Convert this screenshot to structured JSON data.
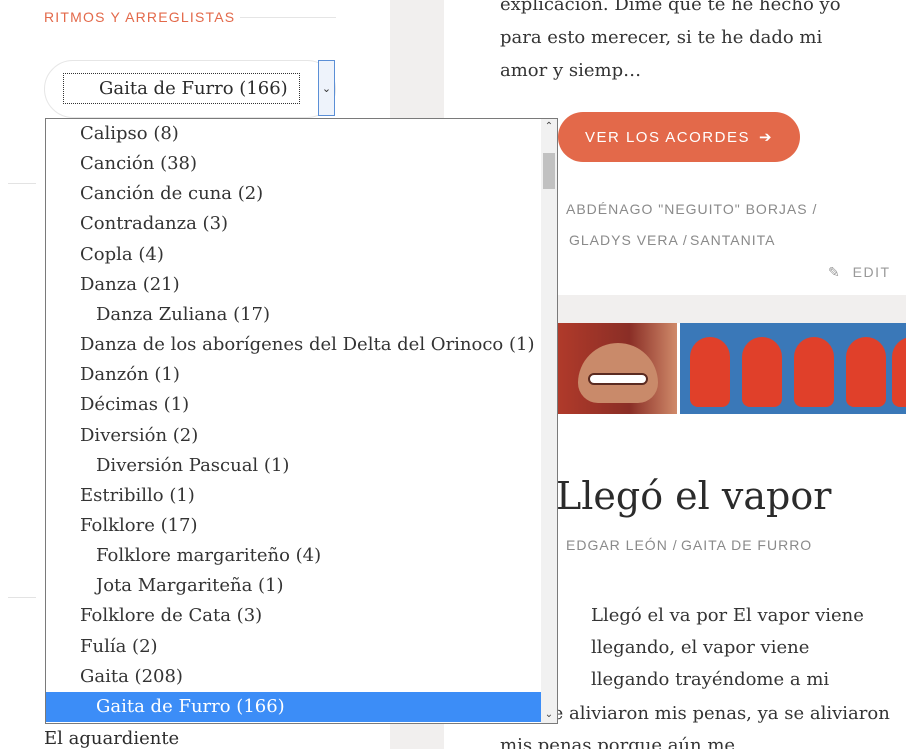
{
  "sidebar": {
    "title": "RITMOS Y ARREGLISTAS",
    "select_value": "Gaita de Furro  (166)",
    "below_text": "El aguardiente"
  },
  "dropdown": {
    "items": [
      {
        "label": "Calipso  (8)",
        "child": false
      },
      {
        "label": "Canción  (38)",
        "child": false
      },
      {
        "label": "Canción de cuna  (2)",
        "child": false
      },
      {
        "label": "Contradanza  (3)",
        "child": false
      },
      {
        "label": "Copla  (4)",
        "child": false
      },
      {
        "label": "Danza  (21)",
        "child": false
      },
      {
        "label": "Danza Zuliana  (17)",
        "child": true
      },
      {
        "label": "Danza de los aborígenes del Delta del Orinoco  (1)",
        "child": false
      },
      {
        "label": "Danzón  (1)",
        "child": false
      },
      {
        "label": "Décimas  (1)",
        "child": false
      },
      {
        "label": "Diversión  (2)",
        "child": false
      },
      {
        "label": "Diversión Pascual  (1)",
        "child": true
      },
      {
        "label": "Estribillo  (1)",
        "child": false
      },
      {
        "label": "Folklore  (17)",
        "child": false
      },
      {
        "label": "Folklore margariteño  (4)",
        "child": true
      },
      {
        "label": "Jota Margariteña  (1)",
        "child": true
      },
      {
        "label": "Folklore de Cata  (3)",
        "child": false
      },
      {
        "label": "Fulía  (2)",
        "child": false
      },
      {
        "label": "Gaita  (208)",
        "child": false
      },
      {
        "label": "Gaita de Furro  (166)",
        "child": true,
        "selected": true
      }
    ]
  },
  "post1": {
    "excerpt": "explicación. Dime que te he hecho yo para esto merecer, si te he dado mi amor y siemp…",
    "button_label": "VER LOS ACORDES",
    "meta_line1": "ABDÉNAGO \"NEGUITO\" BORJAS /",
    "meta_line2_a": "GLADYS VERA /",
    "meta_line2_b": "SANTANITA",
    "edit_label": "EDIT"
  },
  "post2": {
    "title": "Llegó el vapor",
    "meta_author": "EDGAR LEÓN /",
    "meta_rhythm": "GAITA DE FURRO",
    "content": "Llegó el va por El vapor viene llegando, el vapor viene llegando trayéndome a mi",
    "content2": "a Ya se aliviaron mis penas, ya se aliviaron mis penas porque aún me"
  },
  "colors": {
    "accent": "#e3694a",
    "selection": "#3c8df7"
  }
}
